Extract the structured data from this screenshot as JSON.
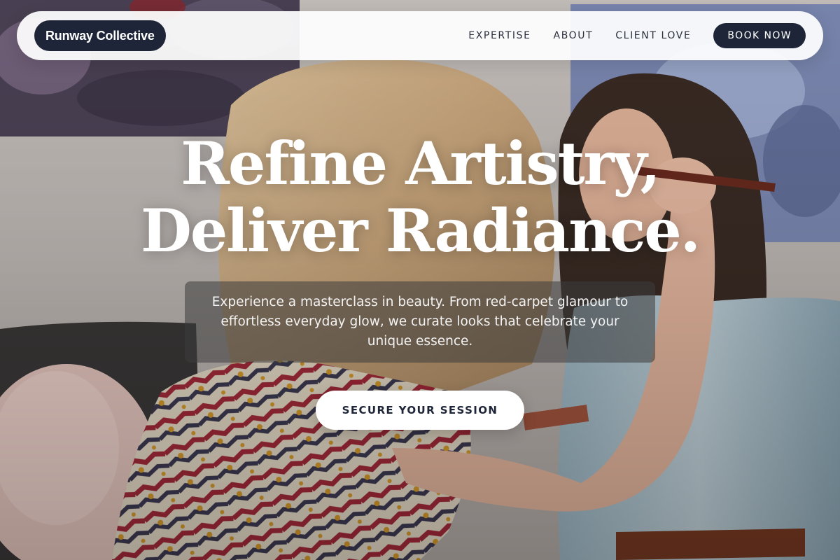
{
  "brand": {
    "name": "Runway Collective"
  },
  "nav": {
    "links": [
      "EXPERTISE",
      "ABOUT",
      "CLIENT LOVE"
    ],
    "book_label": "BOOK NOW"
  },
  "hero": {
    "headline_line1": "Refine Artistry,",
    "headline_line2": "Deliver Radiance.",
    "subtitle": "Experience a masterclass in beauty. From red-carpet glamour to effortless everyday glow, we curate looks that celebrate your unique essence.",
    "cta_label": "SECURE YOUR SESSION",
    "background_image": "makeup-artist-applying-makeup-photo"
  },
  "colors": {
    "primary": "#1e2538",
    "nav_background": "#ffffff",
    "text_light": "#ffffff"
  }
}
